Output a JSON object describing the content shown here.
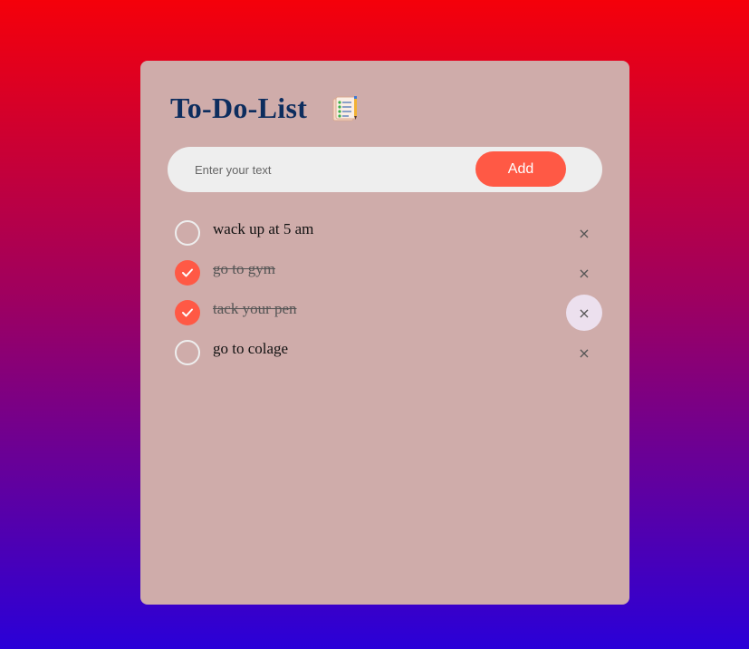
{
  "app": {
    "title": "To-Do-List",
    "title_icon": "notepad-checklist-icon"
  },
  "input": {
    "value": "",
    "placeholder": "Enter your text"
  },
  "add_button": {
    "label": "Add"
  },
  "tasks": [
    {
      "text": "wack up at 5 am",
      "checked": false,
      "delete_label": "×"
    },
    {
      "text": "go to gym",
      "checked": true,
      "delete_label": "×"
    },
    {
      "text": "tack your pen",
      "checked": true,
      "delete_label": "×",
      "hovered": true
    },
    {
      "text": "go to colage",
      "checked": false,
      "delete_label": "×"
    }
  ],
  "colors": {
    "accent": "#ff5945",
    "card_bg": "#cfacaa",
    "title": "#0d2d5e",
    "bg_top": "#f5000a",
    "bg_bottom": "#2a00d8"
  }
}
